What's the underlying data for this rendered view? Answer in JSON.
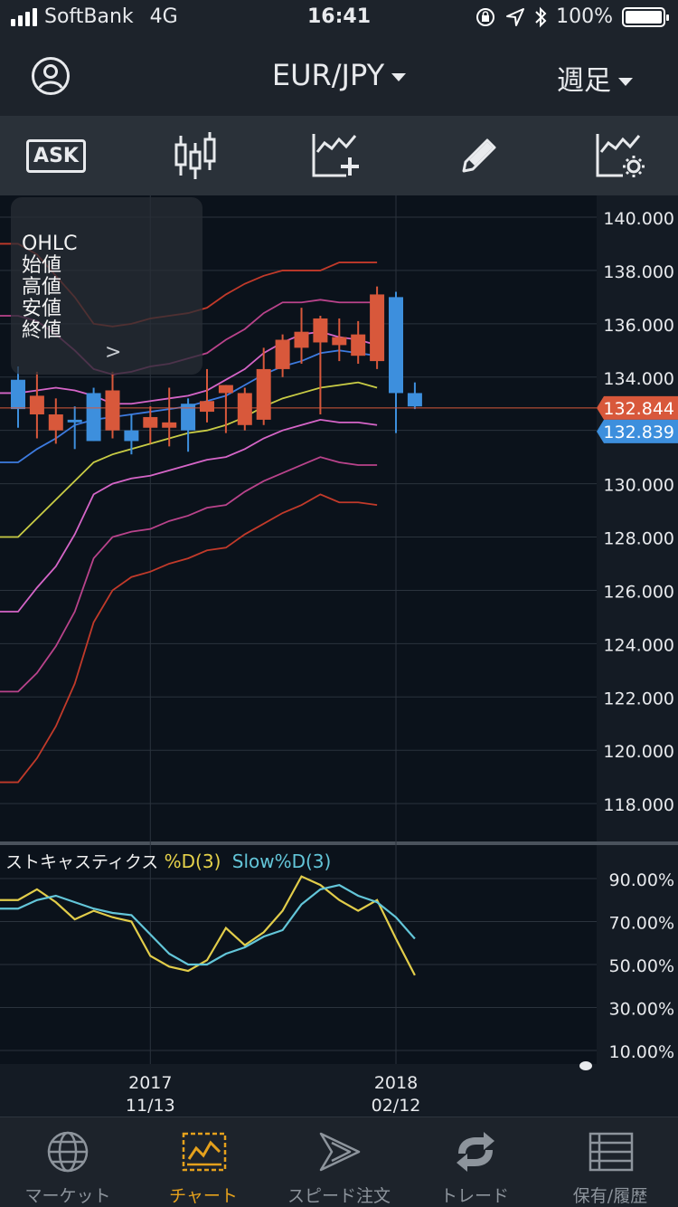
{
  "status": {
    "carrier": "SoftBank",
    "network": "4G",
    "time": "16:41",
    "battery": "100%"
  },
  "nav": {
    "pair": "EUR/JPY",
    "timeframe": "週足"
  },
  "toolbar": {
    "ask_label": "ASK",
    "icons": [
      "candlestick-icon",
      "add-indicator-icon",
      "pencil-icon",
      "chart-settings-icon"
    ]
  },
  "overlay": {
    "lines": [
      "OHLC",
      "始値",
      "高値",
      "安値",
      "終値"
    ],
    "arrow": ">"
  },
  "price_tags": {
    "ask": "132.844",
    "bid": "132.839",
    "ask_color": "#d8583b",
    "bid_color": "#3d8fdd"
  },
  "stoch": {
    "title": "ストキャスティクス",
    "k_label": "%D(3)",
    "d_label": "Slow%D(3)"
  },
  "chart_data": [
    {
      "type": "candlestick",
      "ylim": [
        116.5,
        140.6
      ],
      "yticks": [
        "140.000",
        "138.000",
        "136.000",
        "134.000",
        "132.000",
        "130.000",
        "128.000",
        "126.000",
        "124.000",
        "122.000",
        "120.000",
        "118.000"
      ],
      "ytick_values": [
        140,
        138,
        136,
        134,
        132,
        130,
        128,
        126,
        124,
        122,
        120,
        118
      ],
      "xticks": [
        {
          "index": 7,
          "label_top": "2017",
          "label_bottom": "11/13"
        },
        {
          "index": 20,
          "label_top": "2018",
          "label_bottom": "02/12"
        }
      ],
      "last_price": 132.844,
      "candles": [
        {
          "o": 133.9,
          "h": 134.4,
          "l": 132.1,
          "c": 132.8
        },
        {
          "o": 132.6,
          "h": 134.2,
          "l": 131.7,
          "c": 133.3
        },
        {
          "o": 132.0,
          "h": 133.2,
          "l": 131.5,
          "c": 132.6
        },
        {
          "o": 132.4,
          "h": 132.9,
          "l": 131.3,
          "c": 132.3
        },
        {
          "o": 133.4,
          "h": 133.6,
          "l": 131.6,
          "c": 131.6
        },
        {
          "o": 132.0,
          "h": 134.2,
          "l": 131.7,
          "c": 133.5
        },
        {
          "o": 132.0,
          "h": 132.6,
          "l": 131.1,
          "c": 131.6
        },
        {
          "o": 132.1,
          "h": 132.9,
          "l": 131.5,
          "c": 132.5
        },
        {
          "o": 132.1,
          "h": 133.6,
          "l": 131.4,
          "c": 132.3
        },
        {
          "o": 133.0,
          "h": 133.2,
          "l": 131.2,
          "c": 132.0
        },
        {
          "o": 132.7,
          "h": 134.3,
          "l": 132.3,
          "c": 133.1
        },
        {
          "o": 133.4,
          "h": 133.7,
          "l": 131.9,
          "c": 133.7
        },
        {
          "o": 132.2,
          "h": 133.6,
          "l": 132.0,
          "c": 133.4
        },
        {
          "o": 132.4,
          "h": 135.1,
          "l": 132.2,
          "c": 134.3
        },
        {
          "o": 134.3,
          "h": 135.6,
          "l": 134.0,
          "c": 135.4
        },
        {
          "o": 135.1,
          "h": 136.6,
          "l": 134.5,
          "c": 135.7
        },
        {
          "o": 135.3,
          "h": 136.3,
          "l": 132.6,
          "c": 136.2
        },
        {
          "o": 135.2,
          "h": 136.2,
          "l": 134.6,
          "c": 135.5
        },
        {
          "o": 134.8,
          "h": 136.1,
          "l": 134.5,
          "c": 135.6
        },
        {
          "o": 134.6,
          "h": 137.4,
          "l": 134.3,
          "c": 137.1
        },
        {
          "o": 137.0,
          "h": 137.2,
          "l": 131.9,
          "c": 133.4
        },
        {
          "o": 133.4,
          "h": 133.8,
          "l": 132.8,
          "c": 132.9
        }
      ],
      "bands": [
        {
          "color": "#c23a2a",
          "values": [
            118.8,
            119.7,
            120.9,
            122.5,
            124.8,
            126.0,
            126.5,
            126.7,
            127.0,
            127.2,
            127.5,
            127.6,
            128.1,
            128.5,
            128.9,
            129.2,
            129.6,
            129.3,
            129.3,
            129.2
          ]
        },
        {
          "color": "#b9438b",
          "values": [
            122.2,
            122.9,
            123.9,
            125.2,
            127.2,
            128.0,
            128.2,
            128.3,
            128.6,
            128.8,
            129.1,
            129.2,
            129.7,
            130.1,
            130.4,
            130.7,
            131.0,
            130.8,
            130.7,
            130.7
          ]
        },
        {
          "color": "#d665c8",
          "values": [
            125.2,
            126.1,
            126.9,
            128.1,
            129.6,
            130.0,
            130.2,
            130.3,
            130.5,
            130.7,
            130.9,
            131.0,
            131.3,
            131.7,
            132.0,
            132.2,
            132.4,
            132.3,
            132.3,
            132.2
          ]
        },
        {
          "color": "#c9cc45",
          "values": [
            128.0,
            128.7,
            129.4,
            130.1,
            130.8,
            131.1,
            131.3,
            131.5,
            131.7,
            131.9,
            132.0,
            132.2,
            132.5,
            132.9,
            133.2,
            133.4,
            133.6,
            133.7,
            133.8,
            133.6
          ]
        },
        {
          "color": "#3d7be0",
          "values": [
            130.8,
            131.3,
            131.7,
            132.2,
            132.4,
            132.5,
            132.6,
            132.7,
            132.8,
            132.9,
            133.1,
            133.3,
            133.7,
            134.1,
            134.4,
            134.6,
            134.9,
            135.0,
            134.9,
            134.8
          ]
        },
        {
          "color": "#d665c8",
          "values": [
            133.4,
            133.5,
            133.6,
            133.5,
            133.3,
            133.0,
            133.0,
            133.1,
            133.2,
            133.3,
            133.5,
            133.9,
            134.3,
            134.9,
            135.3,
            135.6,
            135.7,
            135.5,
            135.4,
            135.2
          ]
        },
        {
          "color": "#b9438b",
          "values": [
            136.3,
            136.1,
            135.6,
            135.0,
            134.3,
            134.1,
            134.2,
            134.4,
            134.5,
            134.7,
            134.9,
            135.4,
            135.8,
            136.4,
            136.8,
            136.8,
            136.9,
            136.8,
            136.8,
            136.8
          ]
        },
        {
          "color": "#c23a2a",
          "values": [
            139.0,
            138.6,
            137.8,
            137.0,
            136.0,
            135.9,
            136.0,
            136.2,
            136.3,
            136.4,
            136.6,
            137.1,
            137.5,
            137.8,
            138.0,
            138.0,
            138.0,
            138.3,
            138.3,
            138.3
          ]
        }
      ]
    },
    {
      "type": "line",
      "ylim": [
        7,
        95
      ],
      "yticks": [
        "90.00%",
        "70.00%",
        "50.00%",
        "30.00%",
        "10.00%"
      ],
      "ytick_values": [
        90,
        70,
        50,
        30,
        10
      ],
      "series": [
        {
          "name": "%D(3)",
          "color": "#e2cd4a",
          "values": [
            80,
            85,
            79,
            71,
            75,
            72,
            70,
            54,
            49,
            47,
            52,
            67,
            59,
            65,
            75,
            91,
            87,
            80,
            75,
            80,
            62,
            45
          ]
        },
        {
          "name": "Slow%D(3)",
          "color": "#63c6d9",
          "values": [
            76,
            80,
            82,
            79,
            76,
            74,
            73,
            64,
            55,
            50,
            50,
            55,
            58,
            63,
            66,
            78,
            85,
            87,
            82,
            79,
            72,
            62
          ]
        }
      ]
    }
  ]
}
